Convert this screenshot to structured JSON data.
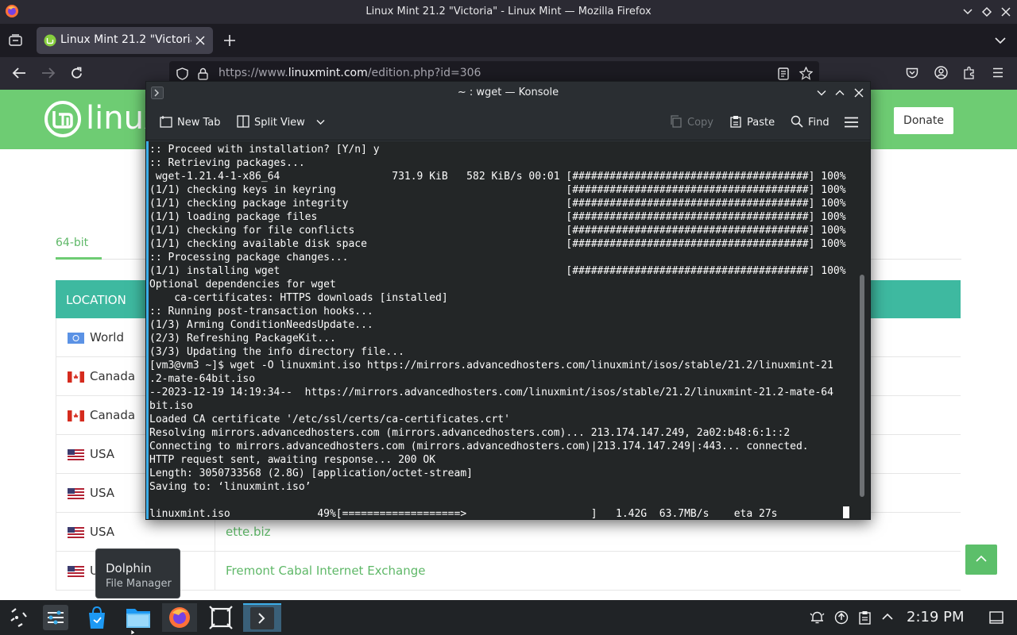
{
  "window": {
    "title": "Linux Mint 21.2 \"Victoria\" - Linux Mint — Mozilla Firefox"
  },
  "browser": {
    "tab_title": "Linux Mint 21.2 \"Victoria\"",
    "url_prefix": "https://www.",
    "url_domain": "linuxmint.com",
    "url_path": "/edition.php?id=306"
  },
  "page": {
    "logo_text": "linux",
    "donate_label": "Donate",
    "arch_tab": "64-bit",
    "location_header": "LOCATION",
    "mirrors": [
      {
        "country": "World",
        "flag": "un-flag",
        "mirror": ""
      },
      {
        "country": "Canada",
        "flag": "canada-flag",
        "mirror": ""
      },
      {
        "country": "Canada",
        "flag": "canada-flag",
        "mirror": ""
      },
      {
        "country": "USA",
        "flag": "usa-flag",
        "mirror": ""
      },
      {
        "country": "USA",
        "flag": "usa-flag",
        "mirror": ""
      },
      {
        "country": "USA",
        "flag": "usa-flag",
        "mirror": "ette.biz"
      },
      {
        "country": "U",
        "flag": "usa-flag",
        "mirror": "Fremont Cabal Internet Exchange"
      }
    ]
  },
  "konsole": {
    "title": "~ : wget — Konsole",
    "toolbar": {
      "new_tab": "New Tab",
      "split_view": "Split View",
      "copy": "Copy",
      "paste": "Paste",
      "find": "Find"
    },
    "output": ":: Proceed with installation? [Y/n] y\n:: Retrieving packages...\n wget-1.21.4-1-x86_64                  731.9 KiB   582 KiB/s 00:01 [######################################] 100%\n(1/1) checking keys in keyring                                     [######################################] 100%\n(1/1) checking package integrity                                   [######################################] 100%\n(1/1) loading package files                                        [######################################] 100%\n(1/1) checking for file conflicts                                  [######################################] 100%\n(1/1) checking available disk space                                [######################################] 100%\n:: Processing package changes...\n(1/1) installing wget                                              [######################################] 100%\nOptional dependencies for wget\n    ca-certificates: HTTPS downloads [installed]\n:: Running post-transaction hooks...\n(1/3) Arming ConditionNeedsUpdate...\n(2/3) Refreshing PackageKit...\n(3/3) Updating the info directory file...\n[vm3@vm3 ~]$ wget -O linuxmint.iso https://mirrors.advancedhosters.com/linuxmint/isos/stable/21.2/linuxmint-21\n.2-mate-64bit.iso\n--2023-12-19 14:19:34--  https://mirrors.advancedhosters.com/linuxmint/isos/stable/21.2/linuxmint-21.2-mate-64\nbit.iso\nLoaded CA certificate '/etc/ssl/certs/ca-certificates.crt'\nResolving mirrors.advancedhosters.com (mirrors.advancedhosters.com)... 213.174.147.249, 2a02:b48:6:1::2\nConnecting to mirrors.advancedhosters.com (mirrors.advancedhosters.com)|213.174.147.249|:443... connected.\nHTTP request sent, awaiting response... 200 OK\nLength: 3050733568 (2.8G) [application/octet-stream]\nSaving to: ‘linuxmint.iso’\n\nlinuxmint.iso              49%[===================>                    ]   1.42G  63.7MB/s    eta 27s"
  },
  "tooltip": {
    "title": "Dolphin",
    "subtitle": "File Manager"
  },
  "taskbar": {
    "apps": [
      "app-launcher-icon",
      "system-settings-icon",
      "discover-icon",
      "dolphin-icon",
      "firefox-icon",
      "screenshot-icon",
      "konsole-icon"
    ],
    "clock": "2:19 PM"
  },
  "colors": {
    "mint_green": "#6ecc73",
    "teal_header": "#3eb9a0",
    "link_green": "#5fb868",
    "terminal_bg": "#232627"
  }
}
